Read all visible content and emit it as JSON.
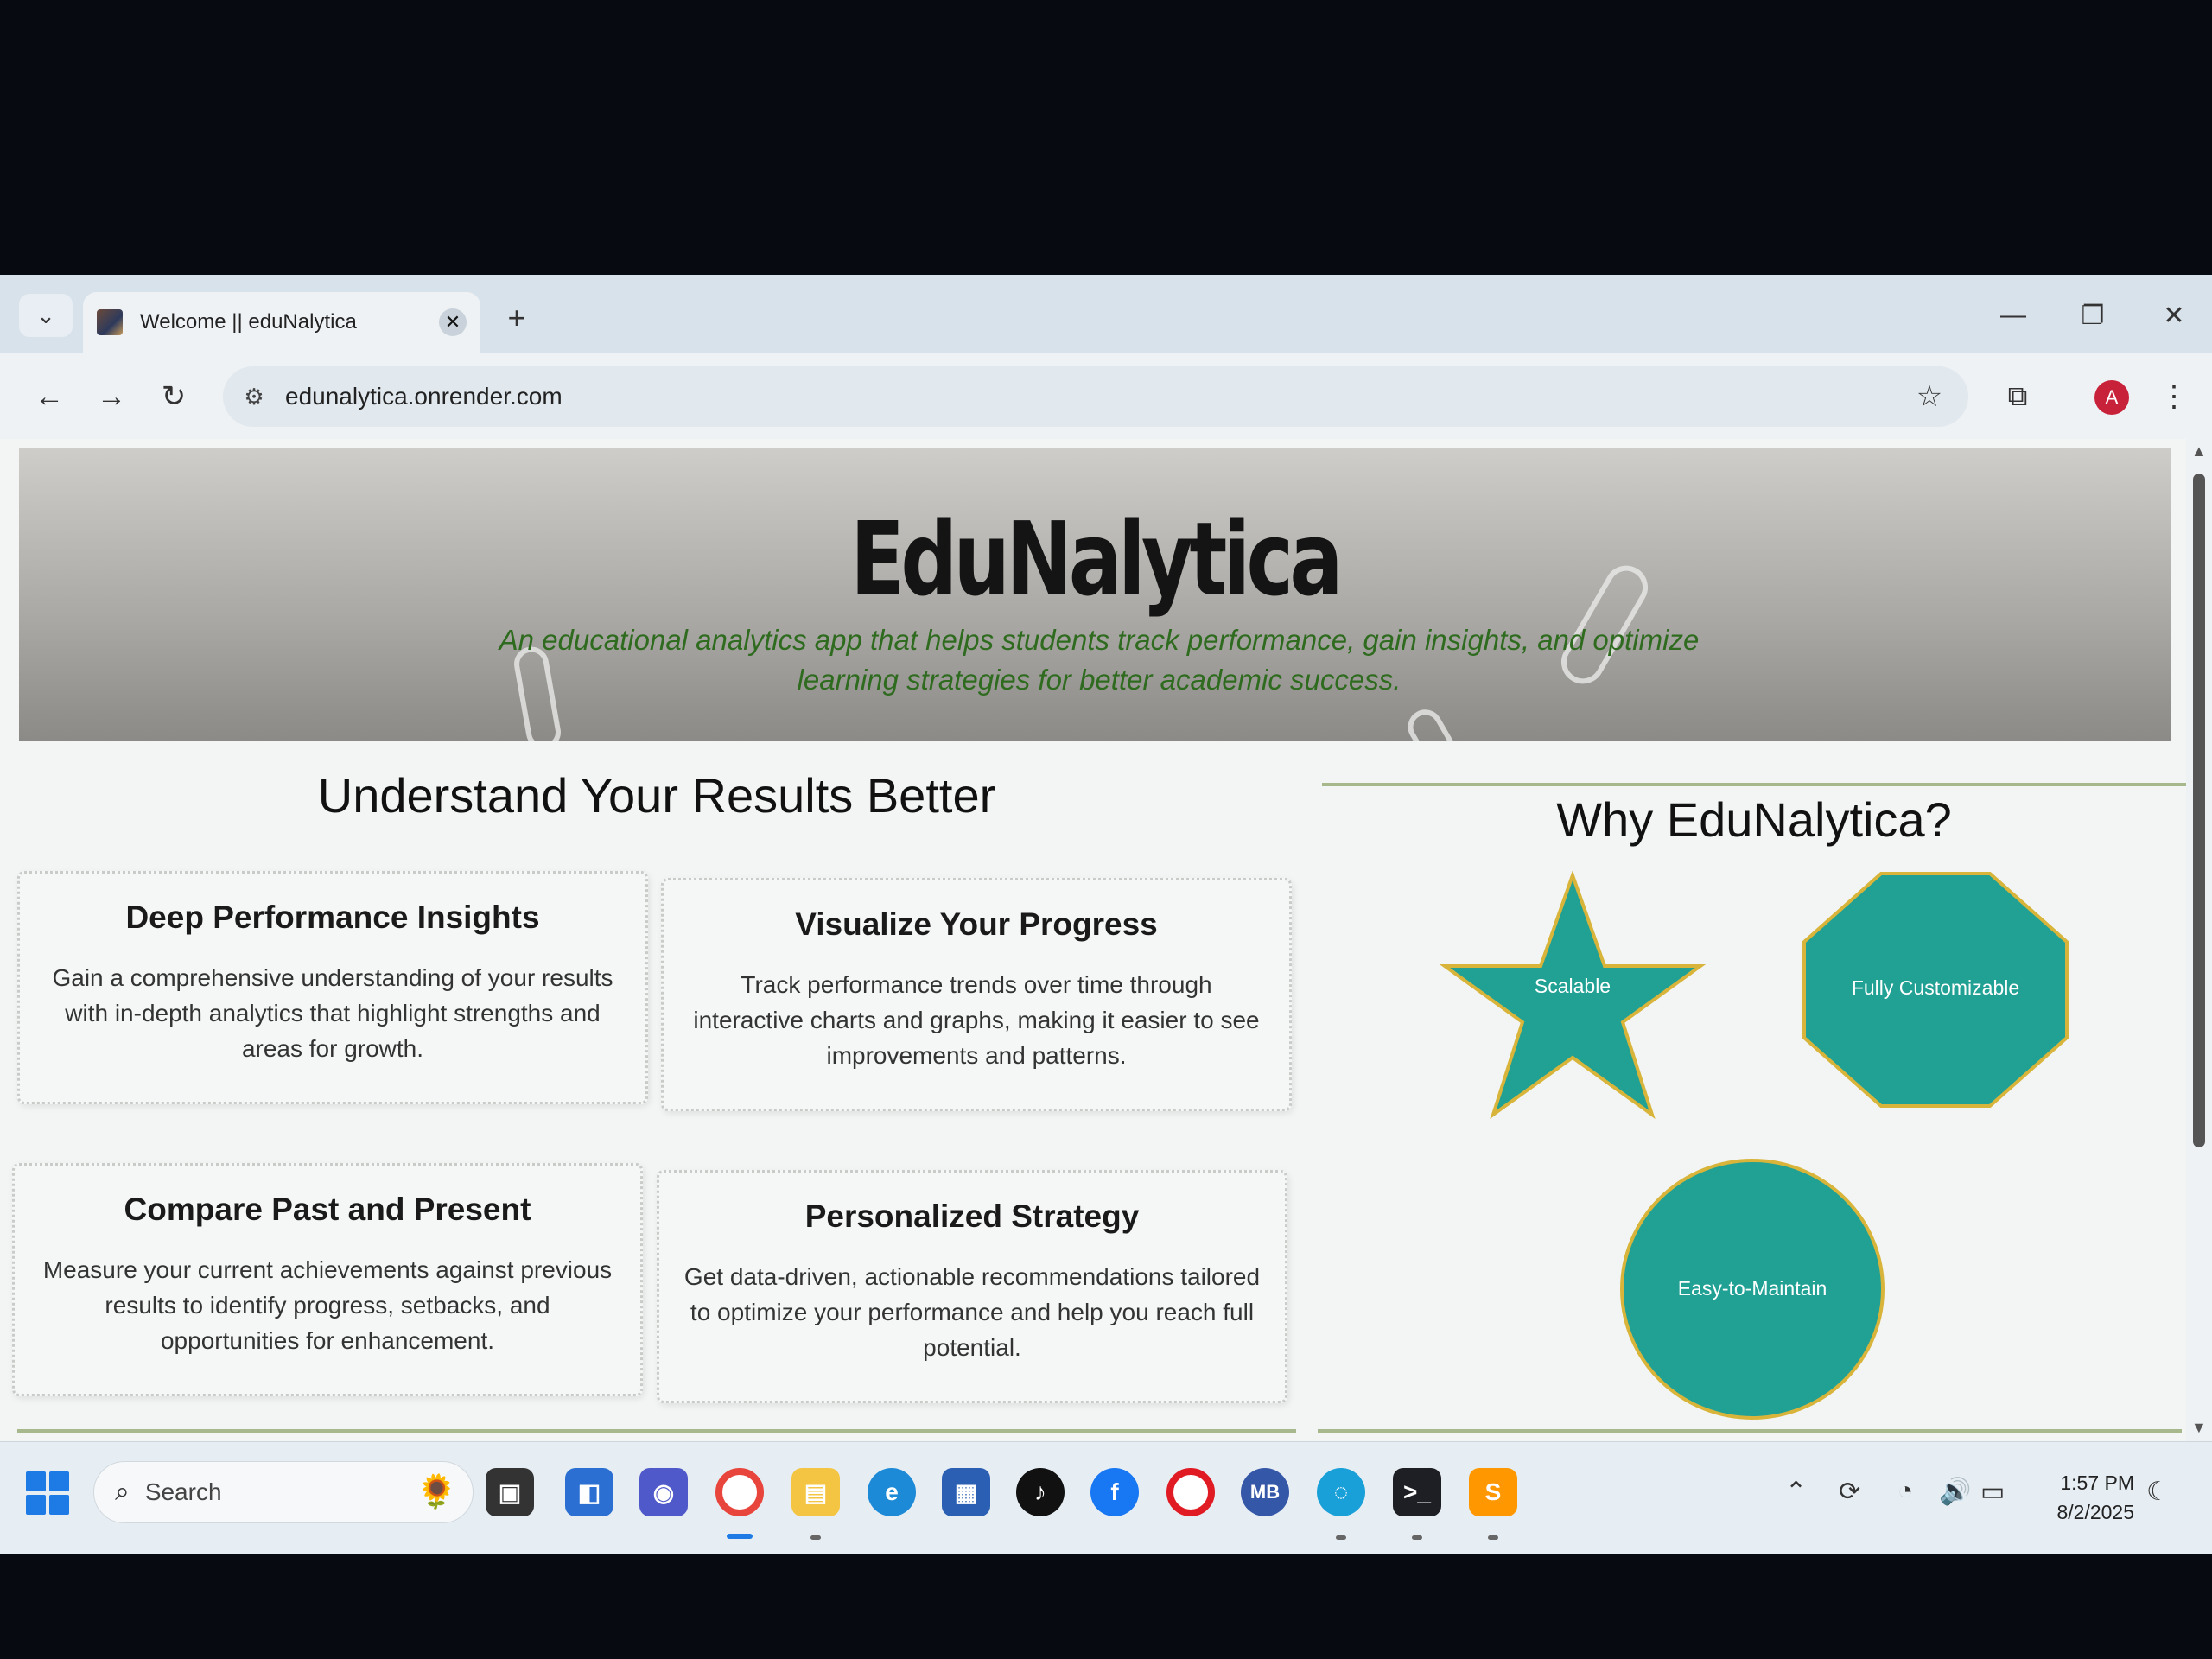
{
  "browser": {
    "tab_title": "Welcome || eduNalytica",
    "tab_close": "✕",
    "new_tab": "+",
    "url": "edunalytica.onrender.com",
    "controls": {
      "minimize": "—",
      "restore": "❐",
      "close": "✕"
    },
    "profile_initial": "A"
  },
  "hero": {
    "title": "EduNalytica",
    "subtitle": "An educational analytics app that helps students track performance, gain insights, and optimize learning strategies for better academic success."
  },
  "results": {
    "heading": "Understand Your Results Better",
    "cards": [
      {
        "title": "Deep Performance Insights",
        "text": "Gain a comprehensive understanding of your results with in-depth analytics that highlight strengths and areas for growth."
      },
      {
        "title": "Visualize Your Progress",
        "text": "Track performance trends over time through interactive charts and graphs, making it easier to see improvements and patterns."
      },
      {
        "title": "Compare Past and Present",
        "text": "Measure your current achievements against previous results to identify progress, setbacks, and opportunities for enhancement."
      },
      {
        "title": "Personalized Strategy",
        "text": "Get data-driven, actionable recommendations tailored to optimize your performance and help you reach full potential."
      }
    ]
  },
  "why": {
    "heading": "Why EduNalytica?",
    "features": [
      "Scalable",
      "Fully Customizable",
      "Easy-to-Maintain"
    ],
    "shape_color": "#21a094",
    "shape_border": "#d8b53a"
  },
  "taskbar": {
    "search_placeholder": "Search",
    "time": "1:57 PM",
    "date": "8/2/2025",
    "apps": [
      "task-view",
      "widgets",
      "teams",
      "chrome",
      "file-explorer",
      "edge",
      "store",
      "tiktok",
      "facebook",
      "opera",
      "mb",
      "edge-dev",
      "terminal",
      "sublime-text"
    ]
  }
}
